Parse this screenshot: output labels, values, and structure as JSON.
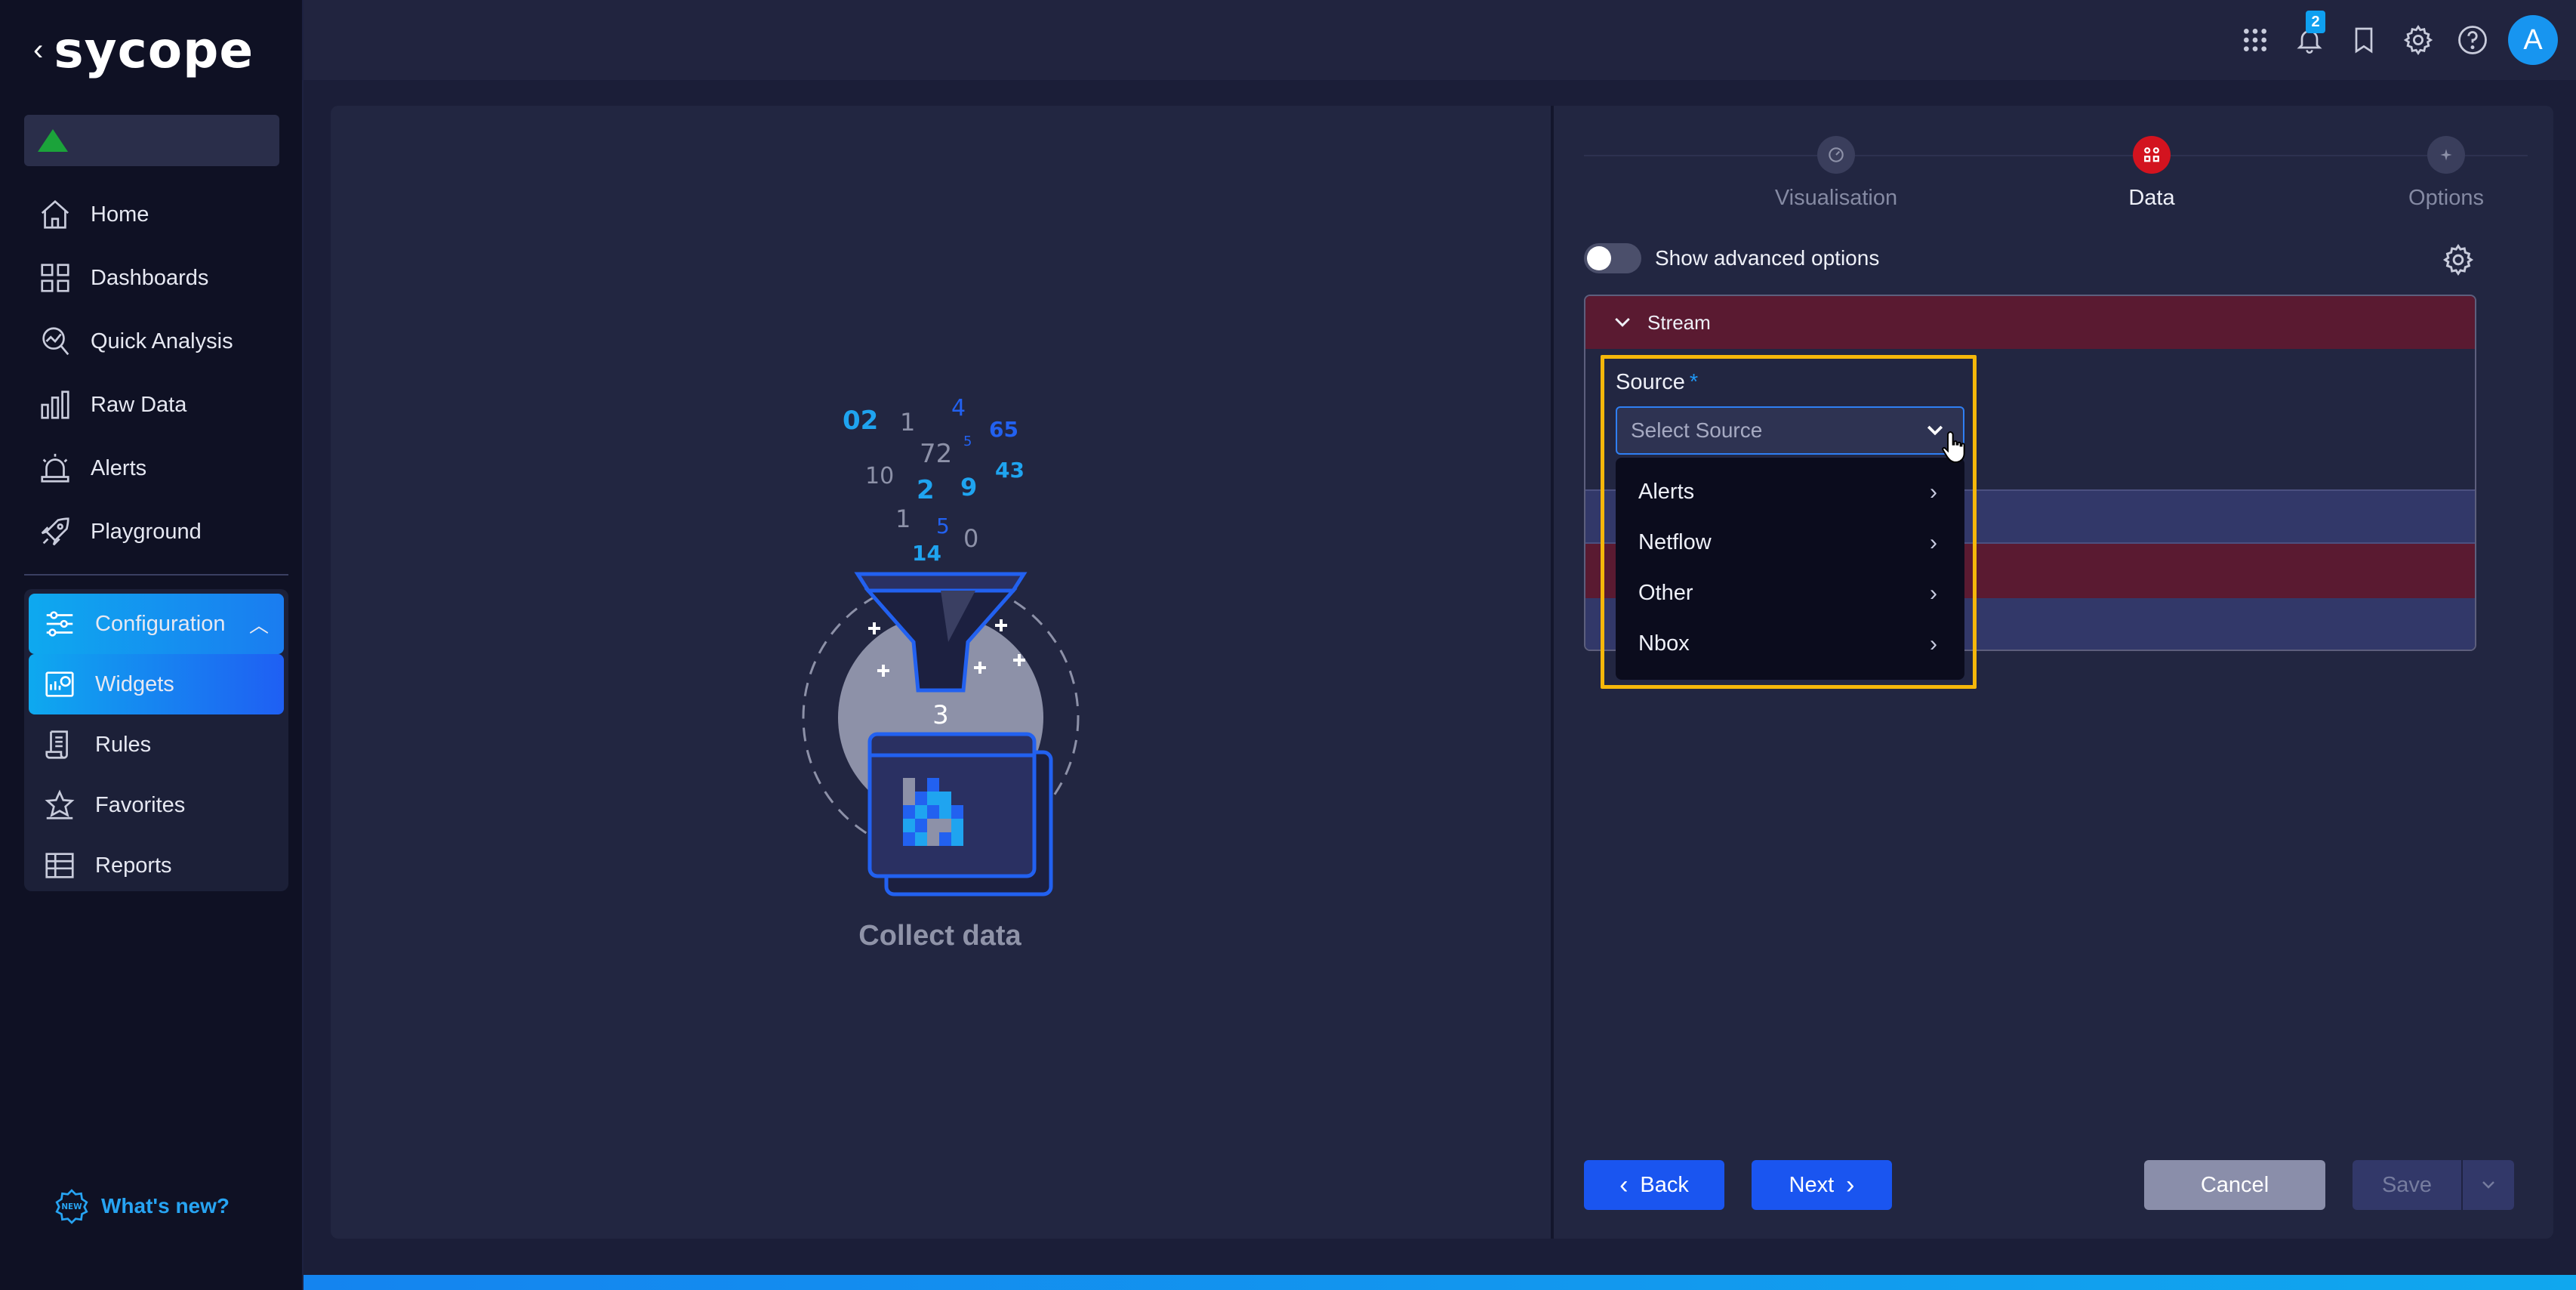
{
  "app": {
    "brand": "sycope",
    "back_chevron": "‹"
  },
  "sidebar": {
    "main_items": [
      {
        "label": "Home",
        "icon": "home-icon"
      },
      {
        "label": "Dashboards",
        "icon": "dashboards-icon"
      },
      {
        "label": "Quick Analysis",
        "icon": "quick-analysis-icon"
      },
      {
        "label": "Raw Data",
        "icon": "raw-data-icon"
      },
      {
        "label": "Alerts",
        "icon": "alerts-icon"
      },
      {
        "label": "Playground",
        "icon": "rocket-icon"
      }
    ],
    "config": {
      "label": "Configuration",
      "expanded": true,
      "items": [
        {
          "label": "Widgets",
          "icon": "widgets-icon",
          "active": true
        },
        {
          "label": "Rules",
          "icon": "rules-icon"
        },
        {
          "label": "Favorites",
          "icon": "favorites-icon"
        },
        {
          "label": "Reports",
          "icon": "reports-icon"
        }
      ]
    },
    "whats_new": "What's new?",
    "whats_new_badge": "NEW"
  },
  "topbar": {
    "notification_count": "2",
    "avatar_letter": "A",
    "icons": [
      "apps-grid-icon",
      "bell-icon",
      "bookmark-icon",
      "gear-icon",
      "help-icon"
    ]
  },
  "illustration": {
    "caption": "Collect data",
    "funnel_numbers": [
      "02",
      "1",
      "4",
      "65",
      "72",
      "5",
      "10",
      "43",
      "2",
      "9",
      "1",
      "5",
      "0",
      "14",
      "3"
    ]
  },
  "wizard": {
    "steps": [
      {
        "label": "Visualisation",
        "active": false
      },
      {
        "label": "Data",
        "active": true
      },
      {
        "label": "Options",
        "active": false
      }
    ]
  },
  "form": {
    "advanced_toggle_label": "Show advanced options",
    "advanced_enabled": false,
    "stream_section_label": "Stream",
    "source_label": "Source",
    "required_mark": "*",
    "source_placeholder": "Select Source",
    "source_options": [
      "Alerts",
      "Netflow",
      "Other",
      "Nbox"
    ]
  },
  "buttons": {
    "back": "Back",
    "next": "Next",
    "cancel": "Cancel",
    "save": "Save"
  },
  "colors": {
    "accent": "#1a55f0",
    "active_step": "#d3131f",
    "highlight": "#f5b70a",
    "section_header": "#5a1a31"
  }
}
